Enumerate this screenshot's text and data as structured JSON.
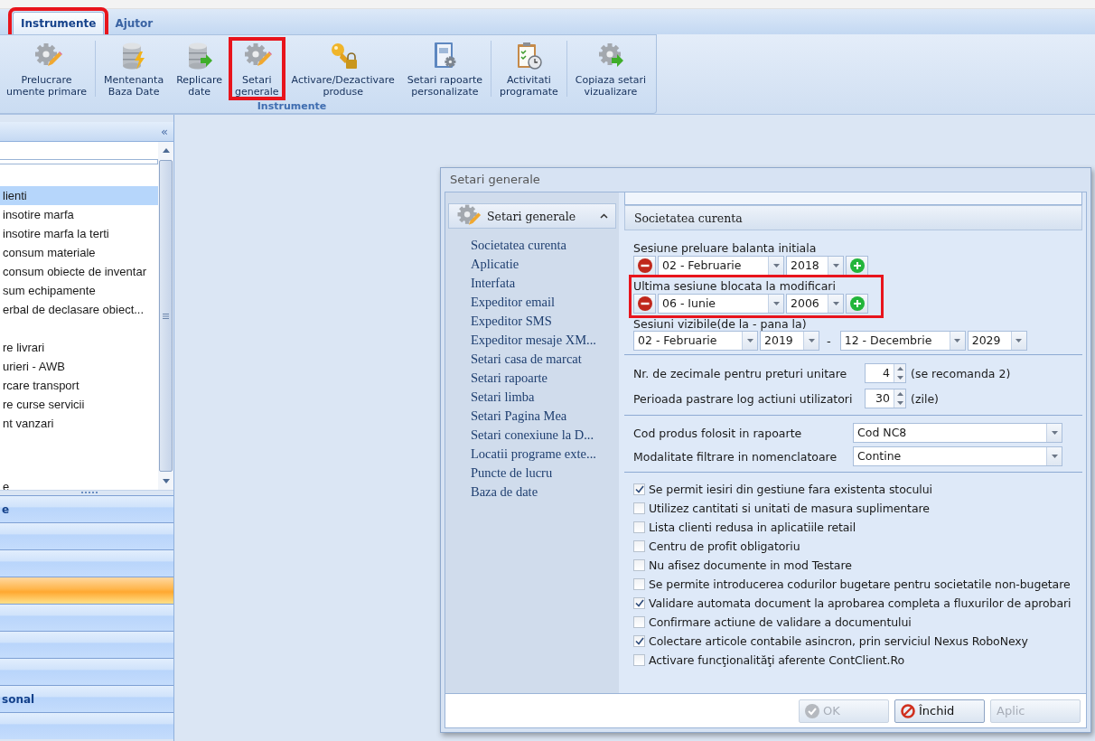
{
  "menu_tabs": [
    {
      "label": "Instrumente",
      "selected": true,
      "highlighted": true
    },
    {
      "label": "Ajutor",
      "selected": false,
      "highlighted": false
    }
  ],
  "ribbon": {
    "group_label": "Instrumente",
    "buttons": [
      {
        "lines": [
          "Prelucrare",
          "umente primare"
        ],
        "highlighted": false,
        "separator_after": true
      },
      {
        "lines": [
          "Mentenanta",
          "Baza Date"
        ],
        "highlighted": false,
        "separator_after": false
      },
      {
        "lines": [
          "Replicare",
          "date"
        ],
        "highlighted": false,
        "separator_after": false
      },
      {
        "lines": [
          "Setari",
          "generale"
        ],
        "highlighted": true,
        "separator_after": false
      },
      {
        "lines": [
          "Activare/Dezactivare",
          "produse"
        ],
        "highlighted": false,
        "separator_after": false
      },
      {
        "lines": [
          "Setari rapoarte",
          "personalizate"
        ],
        "highlighted": false,
        "separator_after": true
      },
      {
        "lines": [
          "Activitati",
          "programate"
        ],
        "highlighted": false,
        "separator_after": true
      },
      {
        "lines": [
          "Copiaza setari",
          "vizualizare"
        ],
        "highlighted": false,
        "separator_after": false
      }
    ]
  },
  "sidebar": {
    "collapse_glyph": "«",
    "list_groups": [
      {
        "items": [
          {
            "label": "lienti",
            "selected": true
          },
          {
            "label": "insotire marfa",
            "selected": false
          },
          {
            "label": "insotire marfa la terti",
            "selected": false
          },
          {
            "label": "consum materiale",
            "selected": false
          },
          {
            "label": "consum obiecte de inventar",
            "selected": false
          },
          {
            "label": "sum echipamente",
            "selected": false
          },
          {
            "label": "erbal de declasare obiect...",
            "selected": false
          }
        ]
      },
      {
        "items": [
          {
            "label": "re livrari",
            "selected": false
          },
          {
            "label": "urieri - AWB",
            "selected": false
          },
          {
            "label": "rcare transport",
            "selected": false
          },
          {
            "label": "re curse servicii",
            "selected": false
          },
          {
            "label": "nt vanzari",
            "selected": false
          }
        ]
      }
    ],
    "last_item": {
      "label": "e",
      "selected": false
    },
    "accordion": [
      {
        "label": "e",
        "selected": false
      },
      {
        "selected": false
      },
      {
        "selected": false
      },
      {
        "selected": true
      },
      {
        "selected": false
      },
      {
        "selected": false
      },
      {
        "selected": false
      },
      {
        "label": "sonal",
        "selected": false
      },
      {
        "selected": false
      }
    ]
  },
  "dialog": {
    "title": "Setari generale",
    "nav": {
      "header": "Setari generale",
      "expanded": true,
      "items": [
        {
          "label": "Societatea curenta"
        },
        {
          "label": "Aplicatie"
        },
        {
          "label": "Interfata"
        },
        {
          "label": "Expeditor email"
        },
        {
          "label": "Expeditor SMS"
        },
        {
          "label": "Expeditor mesaje XM..."
        },
        {
          "label": "Setari casa de marcat"
        },
        {
          "label": "Setari rapoarte"
        },
        {
          "label": "Setari limba"
        },
        {
          "label": "Setari Pagina Mea"
        },
        {
          "label": "Setari conexiune la D..."
        },
        {
          "label": "Locatii programe exte..."
        },
        {
          "label": "Puncte de lucru"
        },
        {
          "label": "Baza de date"
        }
      ]
    },
    "pane_title": "Societatea curenta",
    "sessions": [
      {
        "label": "Sesiune preluare balanta initiala",
        "month": "02 - Februarie",
        "year": "2018",
        "highlighted": false
      },
      {
        "label": "Ultima sesiune blocata la modificari",
        "month": "06 - Iunie",
        "year": "2006",
        "highlighted": true
      }
    ],
    "visible_sessions": {
      "label": "Sesiuni vizibile(de la - pana la)",
      "from_month": "02 - Februarie",
      "from_year": "2019",
      "dash": "-",
      "to_month": "12 - Decembrie",
      "to_year": "2029"
    },
    "spinners": [
      {
        "label": "Nr. de zecimale pentru preturi unitare",
        "value": "4",
        "note": "(se recomanda 2)"
      },
      {
        "label": "Perioada pastrare log actiuni utilizatori",
        "value": "30",
        "note": "(zile)"
      }
    ],
    "dropdowns": [
      {
        "label": "Cod produs folosit in rapoarte",
        "value": "Cod NC8"
      },
      {
        "label": "Modalitate filtrare in nomenclatoare",
        "value": "Contine"
      }
    ],
    "checkboxes": [
      {
        "label": "Se permit iesiri din gestiune fara existenta stocului",
        "checked": true
      },
      {
        "label": "Utilizez cantitati si unitati de masura suplimentare",
        "checked": false
      },
      {
        "label": "Lista clienti redusa in aplicatiile retail",
        "checked": false
      },
      {
        "label": "Centru de profit obligatoriu",
        "checked": false
      },
      {
        "label": "Nu afisez documente in mod Testare",
        "checked": false
      },
      {
        "label": "Se permite introducerea codurilor bugetare pentru societatile non-bugetare",
        "checked": false
      },
      {
        "label": "Validare automata document la aprobarea completa a fluxurilor de aprobari",
        "checked": true
      },
      {
        "label": "Confirmare actiune de validare a documentului",
        "checked": false
      },
      {
        "label": "Colectare articole contabile asincron, prin serviciul Nexus RoboNexy",
        "checked": true
      },
      {
        "label": "Activare funcţionalităţi aferente ContClient.Ro",
        "checked": false
      }
    ],
    "buttons": [
      {
        "label": "OK",
        "kind": "ok",
        "disabled": true
      },
      {
        "label": "Închid",
        "kind": "close",
        "disabled": false
      },
      {
        "label": "Aplic",
        "kind": "apply",
        "disabled": true
      }
    ]
  }
}
